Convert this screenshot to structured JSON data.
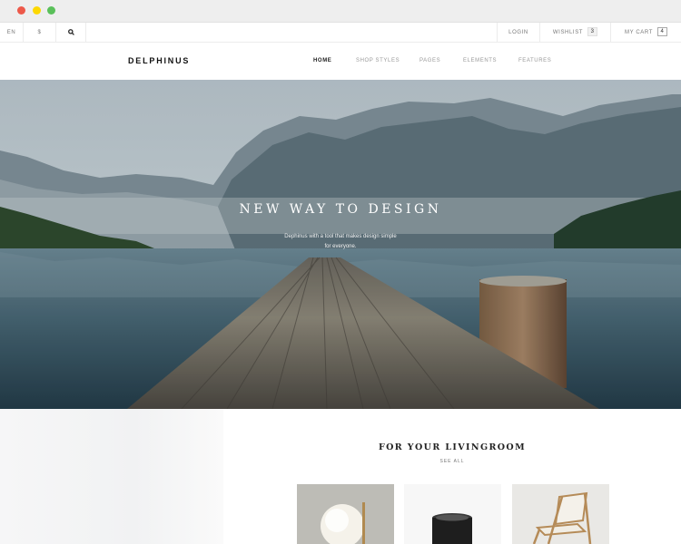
{
  "window": {
    "controls": [
      "close",
      "minimize",
      "maximize"
    ]
  },
  "topbar": {
    "language": "EN",
    "currency": "$",
    "search_icon": "search-icon",
    "login": "LOGIN",
    "wishlist_label": "WISHLIST",
    "wishlist_count": "3",
    "cart_label": "MY CART",
    "cart_count": "4"
  },
  "nav": {
    "logo": "DELPHINUS",
    "items": [
      "HOME",
      "SHOP STYLES",
      "PAGES",
      "ELEMENTS",
      "FEATURES"
    ],
    "active": "HOME"
  },
  "hero": {
    "title": "NEW WAY TO DESIGN",
    "subtitle_line1": "Dephinus with a tool that makes design simple",
    "subtitle_line2": "for everyone."
  },
  "section": {
    "title": "FOR YOUR LIVINGROOM",
    "see_all": "SEE ALL",
    "products": [
      "globe lamp",
      "black stool",
      "wooden chair"
    ]
  },
  "colors": {
    "close": "#ed594a",
    "minimize": "#fdd800",
    "maximize": "#5ac05a",
    "nav_active": "#222222",
    "nav_inactive": "#999999"
  }
}
